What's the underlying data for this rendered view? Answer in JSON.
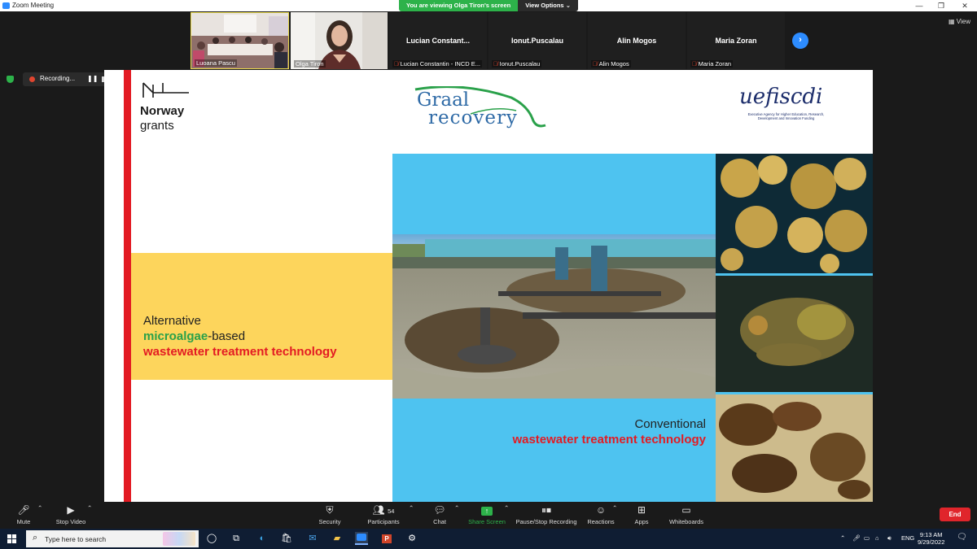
{
  "window": {
    "title": "Zoom Meeting"
  },
  "banner": {
    "message": "You are viewing Olga Tiron's screen",
    "options_label": "View Options"
  },
  "gallery": {
    "tiles": [
      {
        "name": "Luoana Pascu",
        "video": true
      },
      {
        "name": "Olga Tiron",
        "video": true
      },
      {
        "top_name": "Lucian  Constant...",
        "name": "Lucian Constantin - INCD E...",
        "muted": true
      },
      {
        "top_name": "Ionut.Puscalau",
        "name": "Ionut.Puscalau",
        "muted": true
      },
      {
        "top_name": "Alin Mogos",
        "name": "Alin Mogos",
        "muted": true
      },
      {
        "top_name": "Maria Zoran",
        "name": "Maria Zoran",
        "muted": true
      }
    ],
    "view_label": "View"
  },
  "recording": {
    "label": "Recording..."
  },
  "slide": {
    "norway": {
      "line1": "Norway",
      "line2": "grants"
    },
    "graal": {
      "line1": "Graal",
      "line2": "recovery"
    },
    "uefiscdi": {
      "logo": "uefiscdi",
      "caption": "Executive Agency for Higher Education, Research, Development and Innovation Funding"
    },
    "alt": {
      "line1": "Alternative",
      "line2_highlight": "microalgae",
      "line2_rest": "-based",
      "line3": "wastewater treatment technology"
    },
    "conv": {
      "line1": "Conventional",
      "line2": "wastewater treatment technology"
    }
  },
  "toolbar": {
    "mute": "Mute",
    "stop_video": "Stop Video",
    "security": "Security",
    "participants": "Participants",
    "participants_count": "54",
    "chat": "Chat",
    "share_screen": "Share Screen",
    "pause_recording": "Pause/Stop Recording",
    "reactions": "Reactions",
    "apps": "Apps",
    "whiteboards": "Whiteboards",
    "end": "End"
  },
  "taskbar": {
    "search_placeholder": "Type here to search",
    "language": "ENG",
    "time": "9:13 AM",
    "date": "9/29/2022"
  },
  "colors": {
    "zoom_blue": "#2d8cff",
    "share_green": "#2db24a",
    "end_red": "#e0252b",
    "slide_red": "#e31b23",
    "slide_yellow": "#fdd55c",
    "slide_blue": "#4ec3f0"
  }
}
